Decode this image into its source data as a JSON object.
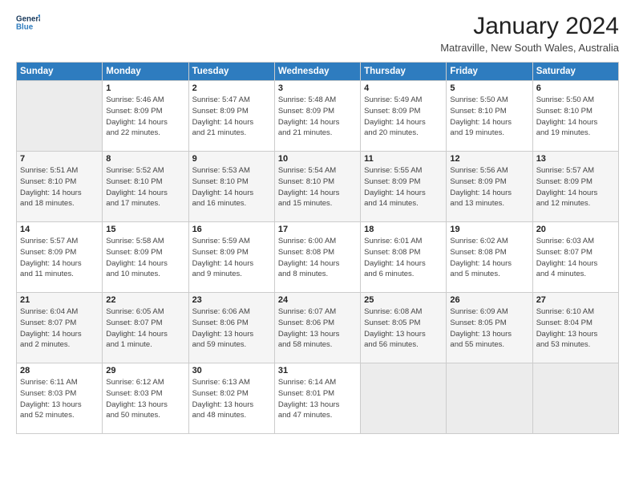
{
  "header": {
    "logo_line1": "General",
    "logo_line2": "Blue",
    "month_title": "January 2024",
    "location": "Matraville, New South Wales, Australia"
  },
  "days_of_week": [
    "Sunday",
    "Monday",
    "Tuesday",
    "Wednesday",
    "Thursday",
    "Friday",
    "Saturday"
  ],
  "weeks": [
    [
      {
        "num": "",
        "info": ""
      },
      {
        "num": "1",
        "info": "Sunrise: 5:46 AM\nSunset: 8:09 PM\nDaylight: 14 hours\nand 22 minutes."
      },
      {
        "num": "2",
        "info": "Sunrise: 5:47 AM\nSunset: 8:09 PM\nDaylight: 14 hours\nand 21 minutes."
      },
      {
        "num": "3",
        "info": "Sunrise: 5:48 AM\nSunset: 8:09 PM\nDaylight: 14 hours\nand 21 minutes."
      },
      {
        "num": "4",
        "info": "Sunrise: 5:49 AM\nSunset: 8:09 PM\nDaylight: 14 hours\nand 20 minutes."
      },
      {
        "num": "5",
        "info": "Sunrise: 5:50 AM\nSunset: 8:10 PM\nDaylight: 14 hours\nand 19 minutes."
      },
      {
        "num": "6",
        "info": "Sunrise: 5:50 AM\nSunset: 8:10 PM\nDaylight: 14 hours\nand 19 minutes."
      }
    ],
    [
      {
        "num": "7",
        "info": "Sunrise: 5:51 AM\nSunset: 8:10 PM\nDaylight: 14 hours\nand 18 minutes."
      },
      {
        "num": "8",
        "info": "Sunrise: 5:52 AM\nSunset: 8:10 PM\nDaylight: 14 hours\nand 17 minutes."
      },
      {
        "num": "9",
        "info": "Sunrise: 5:53 AM\nSunset: 8:10 PM\nDaylight: 14 hours\nand 16 minutes."
      },
      {
        "num": "10",
        "info": "Sunrise: 5:54 AM\nSunset: 8:10 PM\nDaylight: 14 hours\nand 15 minutes."
      },
      {
        "num": "11",
        "info": "Sunrise: 5:55 AM\nSunset: 8:09 PM\nDaylight: 14 hours\nand 14 minutes."
      },
      {
        "num": "12",
        "info": "Sunrise: 5:56 AM\nSunset: 8:09 PM\nDaylight: 14 hours\nand 13 minutes."
      },
      {
        "num": "13",
        "info": "Sunrise: 5:57 AM\nSunset: 8:09 PM\nDaylight: 14 hours\nand 12 minutes."
      }
    ],
    [
      {
        "num": "14",
        "info": "Sunrise: 5:57 AM\nSunset: 8:09 PM\nDaylight: 14 hours\nand 11 minutes."
      },
      {
        "num": "15",
        "info": "Sunrise: 5:58 AM\nSunset: 8:09 PM\nDaylight: 14 hours\nand 10 minutes."
      },
      {
        "num": "16",
        "info": "Sunrise: 5:59 AM\nSunset: 8:09 PM\nDaylight: 14 hours\nand 9 minutes."
      },
      {
        "num": "17",
        "info": "Sunrise: 6:00 AM\nSunset: 8:08 PM\nDaylight: 14 hours\nand 8 minutes."
      },
      {
        "num": "18",
        "info": "Sunrise: 6:01 AM\nSunset: 8:08 PM\nDaylight: 14 hours\nand 6 minutes."
      },
      {
        "num": "19",
        "info": "Sunrise: 6:02 AM\nSunset: 8:08 PM\nDaylight: 14 hours\nand 5 minutes."
      },
      {
        "num": "20",
        "info": "Sunrise: 6:03 AM\nSunset: 8:07 PM\nDaylight: 14 hours\nand 4 minutes."
      }
    ],
    [
      {
        "num": "21",
        "info": "Sunrise: 6:04 AM\nSunset: 8:07 PM\nDaylight: 14 hours\nand 2 minutes."
      },
      {
        "num": "22",
        "info": "Sunrise: 6:05 AM\nSunset: 8:07 PM\nDaylight: 14 hours\nand 1 minute."
      },
      {
        "num": "23",
        "info": "Sunrise: 6:06 AM\nSunset: 8:06 PM\nDaylight: 13 hours\nand 59 minutes."
      },
      {
        "num": "24",
        "info": "Sunrise: 6:07 AM\nSunset: 8:06 PM\nDaylight: 13 hours\nand 58 minutes."
      },
      {
        "num": "25",
        "info": "Sunrise: 6:08 AM\nSunset: 8:05 PM\nDaylight: 13 hours\nand 56 minutes."
      },
      {
        "num": "26",
        "info": "Sunrise: 6:09 AM\nSunset: 8:05 PM\nDaylight: 13 hours\nand 55 minutes."
      },
      {
        "num": "27",
        "info": "Sunrise: 6:10 AM\nSunset: 8:04 PM\nDaylight: 13 hours\nand 53 minutes."
      }
    ],
    [
      {
        "num": "28",
        "info": "Sunrise: 6:11 AM\nSunset: 8:03 PM\nDaylight: 13 hours\nand 52 minutes."
      },
      {
        "num": "29",
        "info": "Sunrise: 6:12 AM\nSunset: 8:03 PM\nDaylight: 13 hours\nand 50 minutes."
      },
      {
        "num": "30",
        "info": "Sunrise: 6:13 AM\nSunset: 8:02 PM\nDaylight: 13 hours\nand 48 minutes."
      },
      {
        "num": "31",
        "info": "Sunrise: 6:14 AM\nSunset: 8:01 PM\nDaylight: 13 hours\nand 47 minutes."
      },
      {
        "num": "",
        "info": ""
      },
      {
        "num": "",
        "info": ""
      },
      {
        "num": "",
        "info": ""
      }
    ]
  ]
}
